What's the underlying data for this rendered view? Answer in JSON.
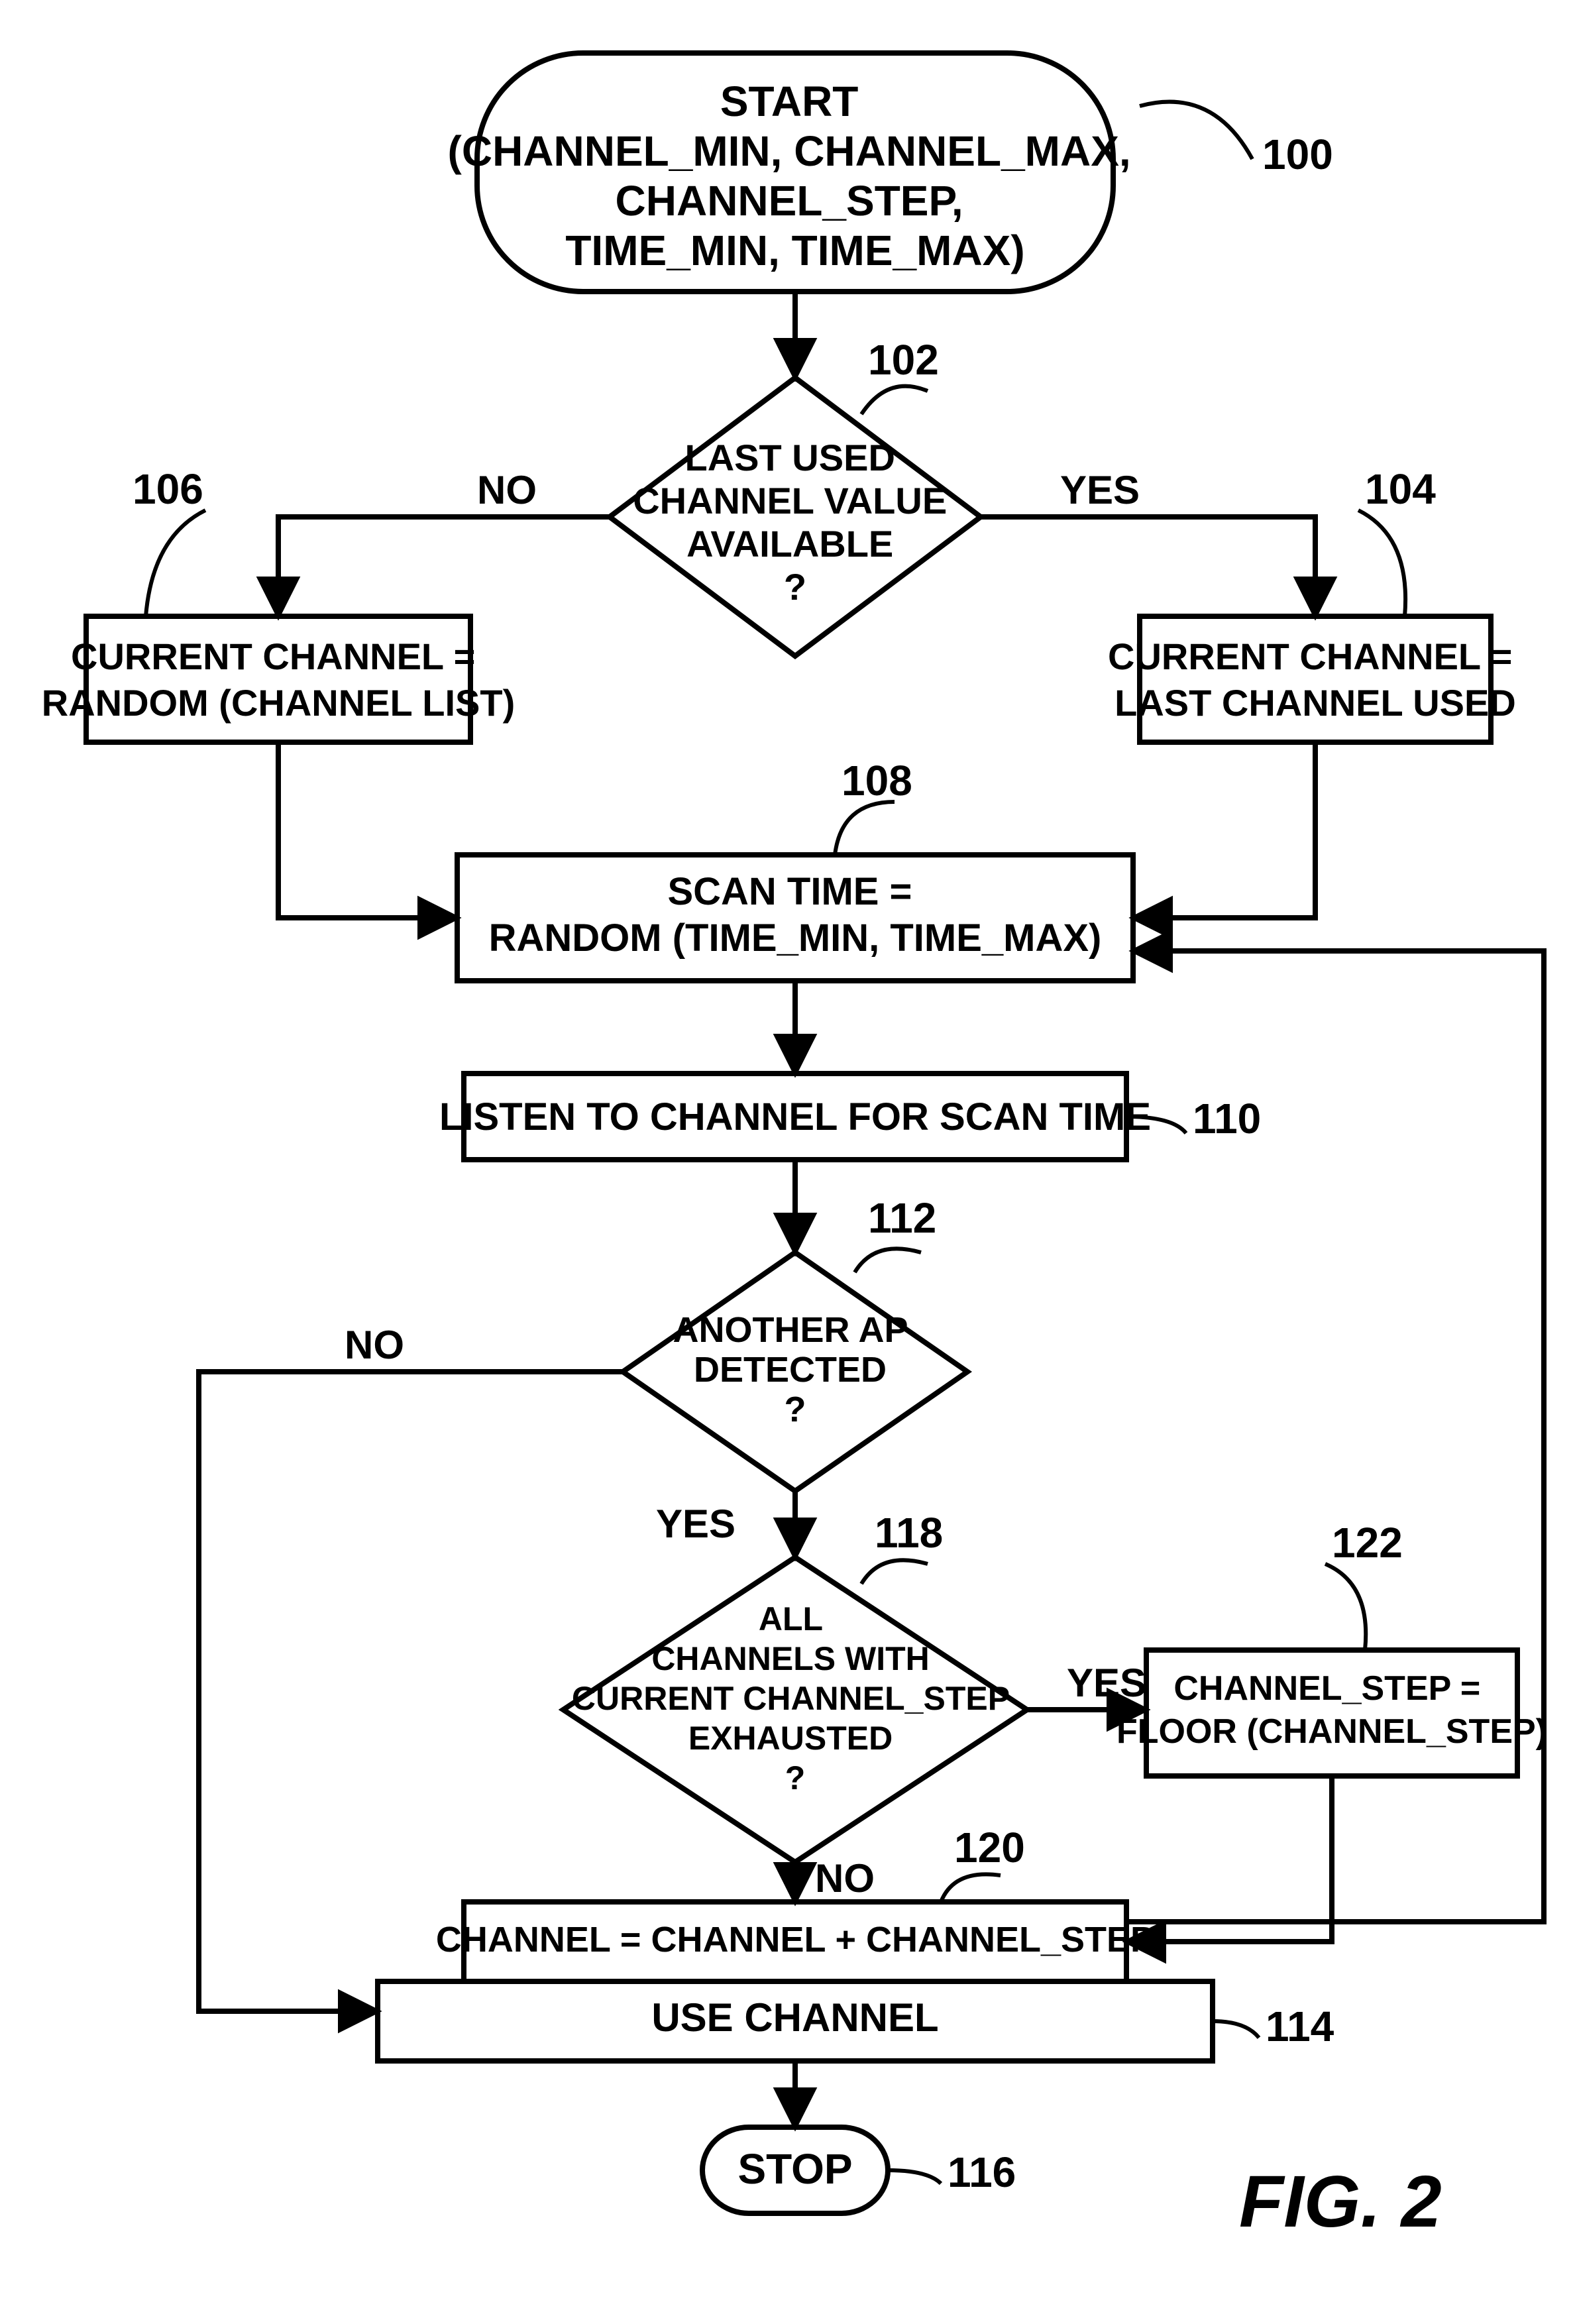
{
  "figure_label": "FIG. 2",
  "nodes": {
    "start": {
      "ref": "100",
      "lines": [
        "START",
        "(CHANNEL_MIN, CHANNEL_MAX,",
        "CHANNEL_STEP,",
        "TIME_MIN, TIME_MAX)"
      ]
    },
    "d_last": {
      "ref": "102",
      "lines": [
        "LAST USED",
        "CHANNEL VALUE",
        "AVAILABLE",
        "?"
      ]
    },
    "p_last": {
      "ref": "104",
      "lines": [
        "CURRENT CHANNEL =",
        "LAST CHANNEL USED"
      ]
    },
    "p_rand": {
      "ref": "106",
      "lines": [
        "CURRENT CHANNEL =",
        "RANDOM (CHANNEL LIST)"
      ]
    },
    "p_scan": {
      "ref": "108",
      "lines": [
        "SCAN TIME =",
        "RANDOM (TIME_MIN, TIME_MAX)"
      ]
    },
    "p_listen": {
      "ref": "110",
      "lines": [
        "LISTEN TO CHANNEL FOR SCAN TIME"
      ]
    },
    "d_ap": {
      "ref": "112",
      "lines": [
        "ANOTHER AP",
        "DETECTED",
        "?"
      ]
    },
    "d_exh": {
      "ref": "118",
      "lines": [
        "ALL",
        "CHANNELS WITH",
        "CURRENT CHANNEL_STEP",
        "EXHAUSTED",
        "?"
      ]
    },
    "p_inc": {
      "ref": "120",
      "lines": [
        "CHANNEL = CHANNEL + CHANNEL_STEP"
      ]
    },
    "p_floor": {
      "ref": "122",
      "lines": [
        "CHANNEL_STEP =",
        "FLOOR (CHANNEL_STEP)"
      ]
    },
    "p_use": {
      "ref": "114",
      "lines": [
        "USE CHANNEL"
      ]
    },
    "stop": {
      "ref": "116",
      "lines": [
        "STOP"
      ]
    }
  },
  "edges": {
    "no": "NO",
    "yes": "YES"
  }
}
